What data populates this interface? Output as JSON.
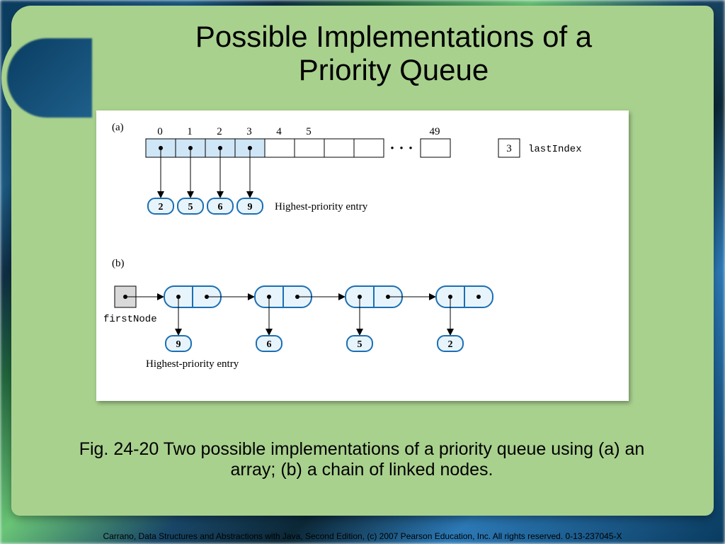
{
  "title_line1": "Possible Implementations of a",
  "title_line2": "Priority Queue",
  "caption": "Fig. 24-20 Two possible implementations of a priority queue using (a) an array; (b) a chain of linked nodes.",
  "credits": "Carrano, Data Structures and Abstractions with Java, Second Edition, (c) 2007 Pearson Education, Inc. All rights reserved. 0-13-237045-X",
  "partA": {
    "label": "(a)",
    "indices": [
      "0",
      "1",
      "2",
      "3",
      "4",
      "5",
      "49"
    ],
    "dots": "• • •",
    "filledCells": 4,
    "values": [
      "2",
      "5",
      "6",
      "9"
    ],
    "highestLabel": "Highest-priority entry",
    "lastIndexValue": "3",
    "lastIndexLabel": "lastIndex"
  },
  "partB": {
    "label": "(b)",
    "firstNodeLabel": "firstNode",
    "values": [
      "9",
      "6",
      "5",
      "2"
    ],
    "highestLabel": "Highest-priority entry"
  }
}
